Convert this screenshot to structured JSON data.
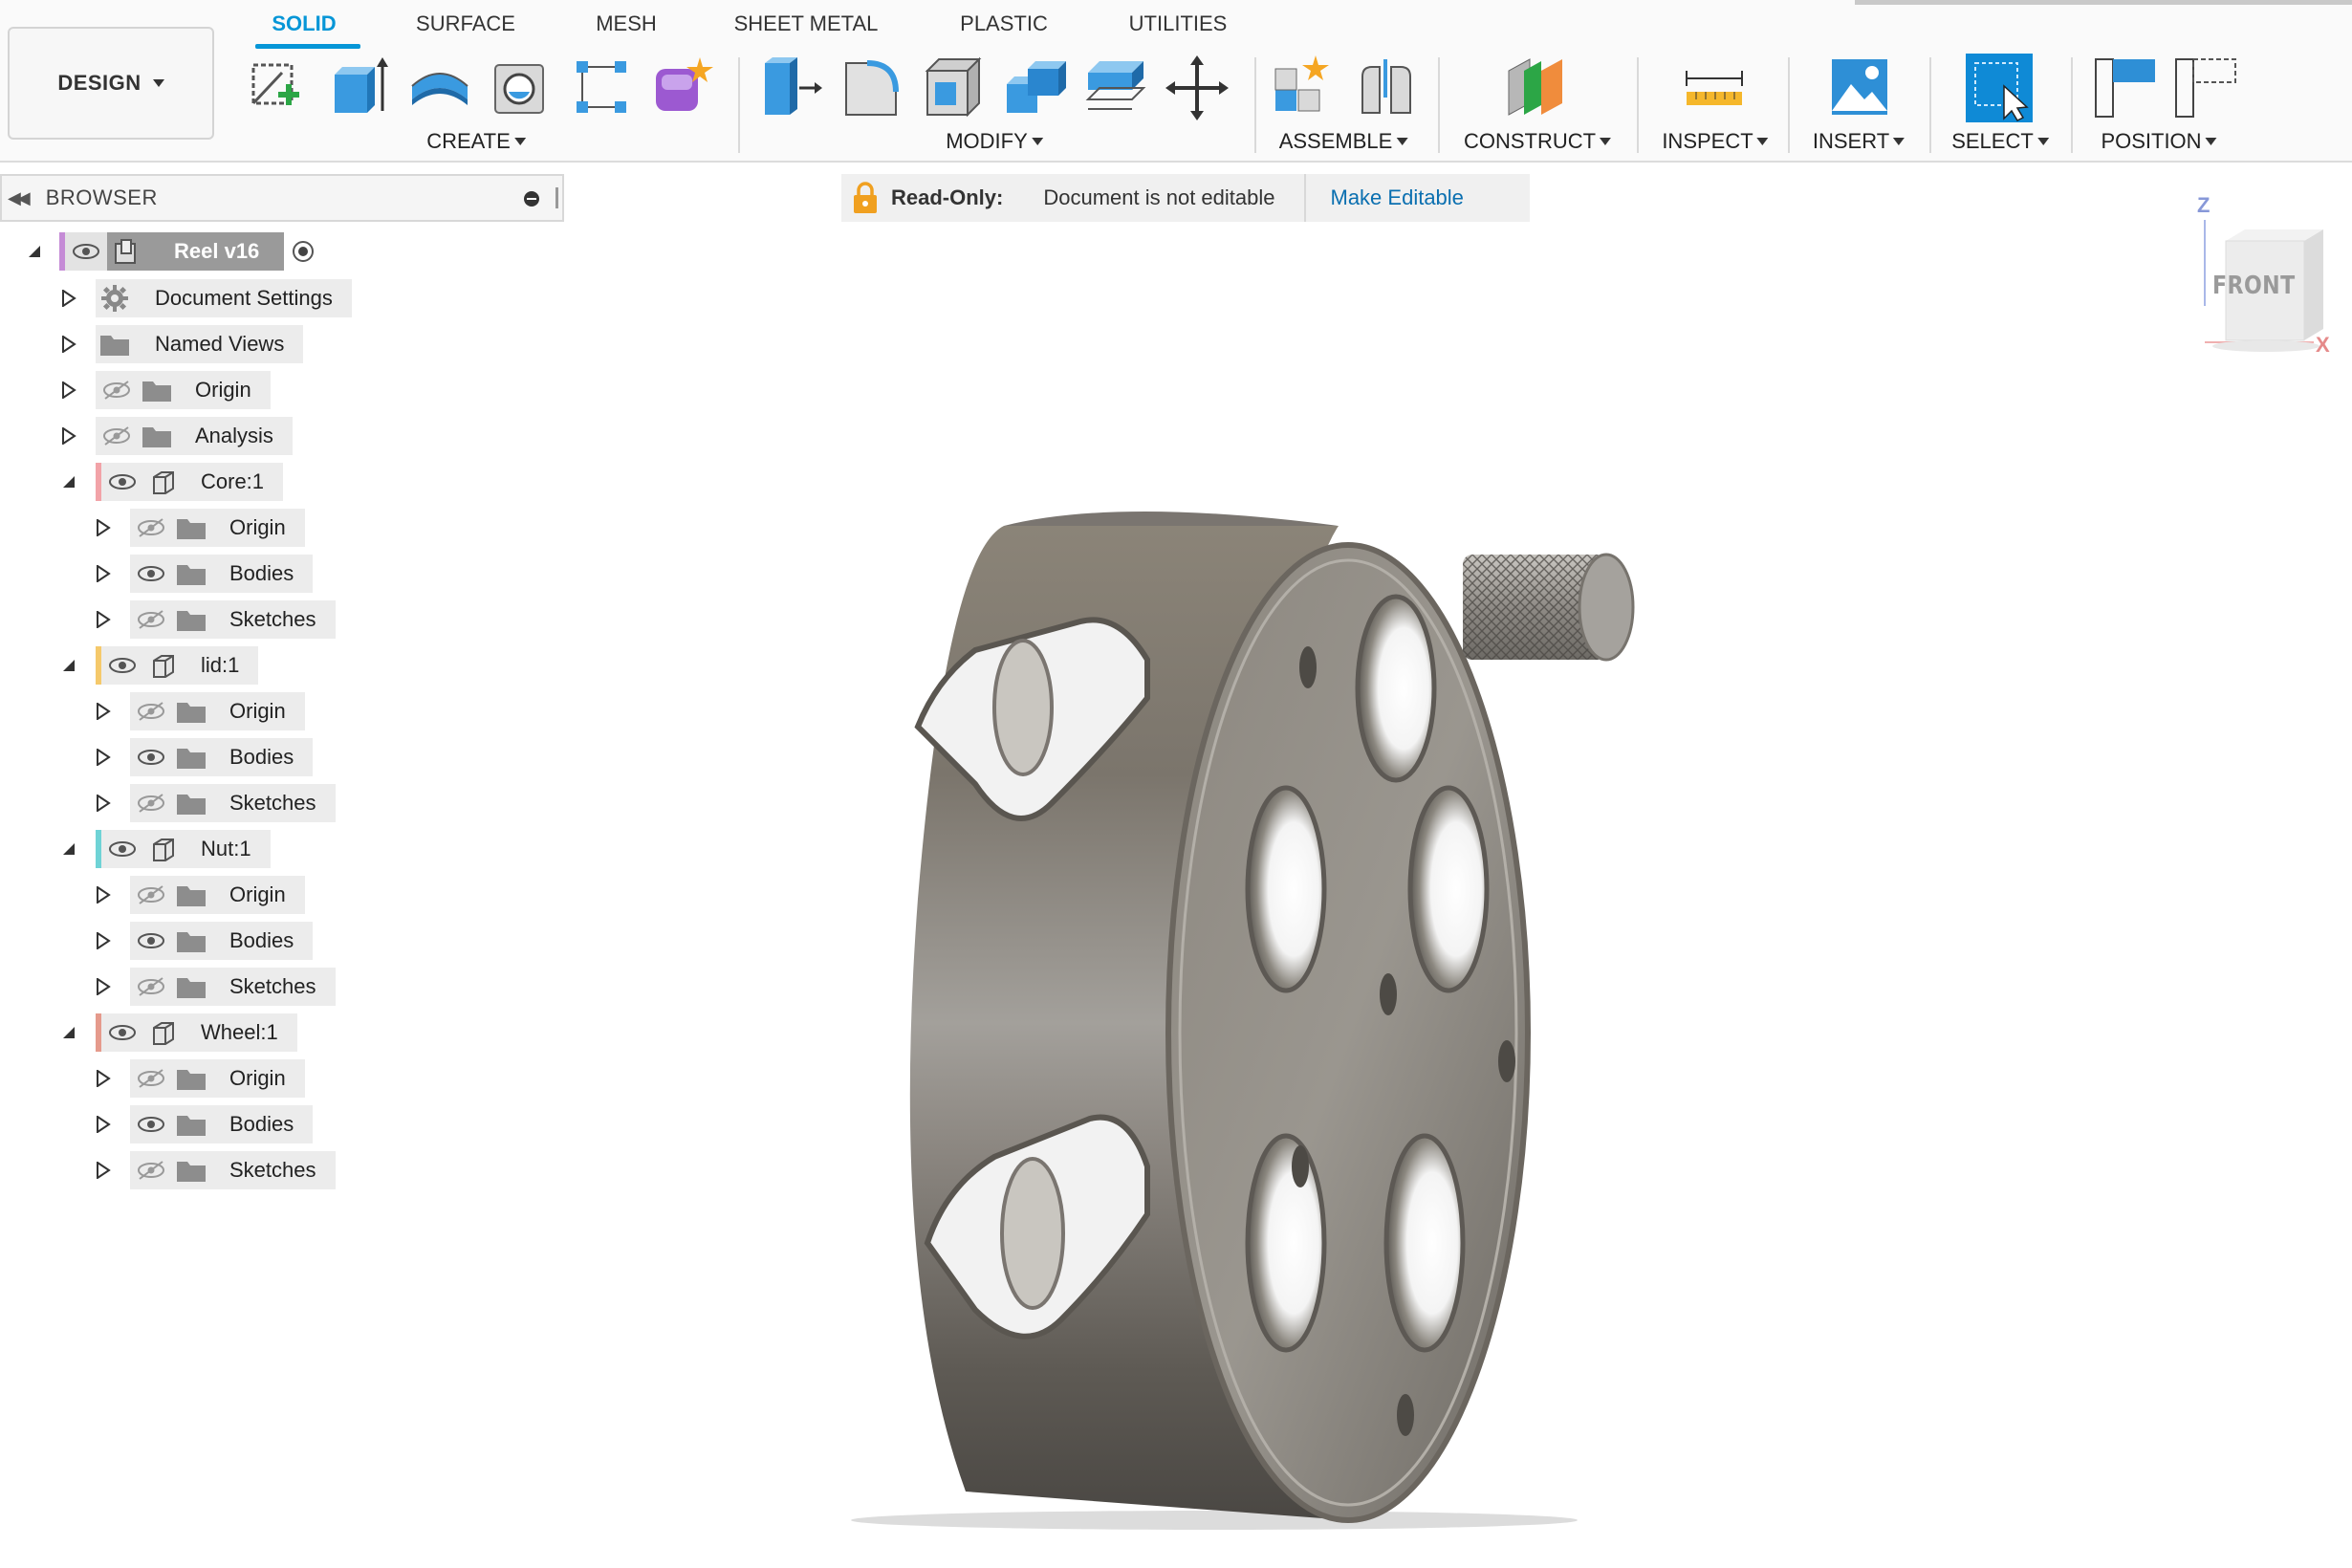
{
  "toolbar": {
    "design_label": "DESIGN",
    "tabs": [
      {
        "label": "SOLID",
        "active": true
      },
      {
        "label": "SURFACE",
        "active": false
      },
      {
        "label": "MESH",
        "active": false
      },
      {
        "label": "SHEET METAL",
        "active": false
      },
      {
        "label": "PLASTIC",
        "active": false
      },
      {
        "label": "UTILITIES",
        "active": false
      }
    ],
    "groups": {
      "create": "CREATE",
      "modify": "MODIFY",
      "assemble": "ASSEMBLE",
      "construct": "CONSTRUCT",
      "inspect": "INSPECT",
      "insert": "INSERT",
      "select": "SELECT",
      "position": "POSITION"
    },
    "accent_color": "#0696d7"
  },
  "browser": {
    "title": "BROWSER",
    "root": {
      "label": "Reel v16",
      "color": "#c58bd6"
    },
    "items": [
      {
        "label": "Document Settings",
        "icon": "gear-icon"
      },
      {
        "label": "Named Views",
        "icon": "folder-icon"
      },
      {
        "label": "Origin",
        "icon": "folder-icon",
        "visible": false
      },
      {
        "label": "Analysis",
        "icon": "folder-icon",
        "visible": false
      }
    ],
    "components": [
      {
        "label": "Core:1",
        "color": "#f2a3a8",
        "children": [
          {
            "label": "Origin",
            "visible": false
          },
          {
            "label": "Bodies",
            "visible": true
          },
          {
            "label": "Sketches",
            "visible": false
          }
        ]
      },
      {
        "label": "lid:1",
        "color": "#f5c96b",
        "children": [
          {
            "label": "Origin",
            "visible": false
          },
          {
            "label": "Bodies",
            "visible": true
          },
          {
            "label": "Sketches",
            "visible": false
          }
        ]
      },
      {
        "label": "Nut:1",
        "color": "#6fd3d6",
        "children": [
          {
            "label": "Origin",
            "visible": false
          },
          {
            "label": "Bodies",
            "visible": true
          },
          {
            "label": "Sketches",
            "visible": false
          }
        ]
      },
      {
        "label": "Wheel:1",
        "color": "#e59a8c",
        "children": [
          {
            "label": "Origin",
            "visible": false
          },
          {
            "label": "Bodies",
            "visible": true
          },
          {
            "label": "Sketches",
            "visible": false
          }
        ]
      }
    ]
  },
  "banner": {
    "label": "Read-Only:",
    "message": "Document is not editable",
    "action": "Make Editable"
  },
  "viewcube": {
    "face": "FRONT",
    "axis_z": "Z",
    "axis_x": "X"
  }
}
